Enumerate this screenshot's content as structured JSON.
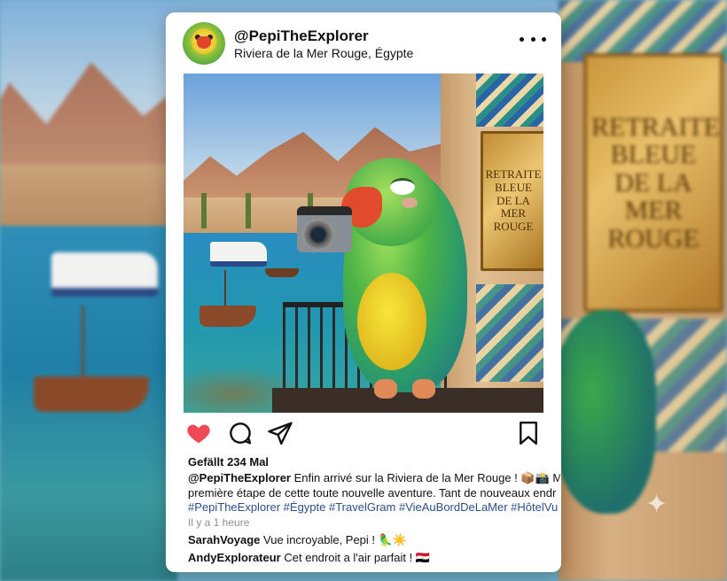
{
  "background": {
    "plaque_lines": [
      "RETRAITE",
      "BLEUE",
      "DE LA MER",
      "ROUGE"
    ]
  },
  "post": {
    "username": "@PepiTheExplorer",
    "location": "Riviera de la Mer Rouge, Égypte",
    "photo": {
      "plaque_lines": [
        "RETRAITE",
        "BLEUE",
        "DE LA MER",
        "ROUGE"
      ]
    },
    "actions": {
      "like_icon": "heart-filled-icon",
      "comment_icon": "comment-bubble-icon",
      "share_icon": "send-paper-plane-icon",
      "save_icon": "bookmark-icon",
      "like_color": "#ed4956"
    },
    "likes_text": "Gefällt 234 Mal",
    "caption": {
      "username": "@PepiTheExplorer",
      "line1_text": "Enfin arrivé sur la Riviera de la Mer Rouge ! 📦📸 M",
      "line2_text": "première étape de cette toute nouvelle aventure. Tant de nouveaux endr",
      "hashtags": "#PepiTheExplorer #Égypte #TravelGram #VieAuBordDeLaMer #HôtelVu"
    },
    "time_ago": "Il y a 1 heure",
    "comments": [
      {
        "username": "SarahVoyage",
        "text": "Vue incroyable, Pepi ! 🦜☀️"
      },
      {
        "username": "AndyExplorateur",
        "text": "Cet endroit a l'air parfait ! 🇪🇬"
      }
    ]
  }
}
